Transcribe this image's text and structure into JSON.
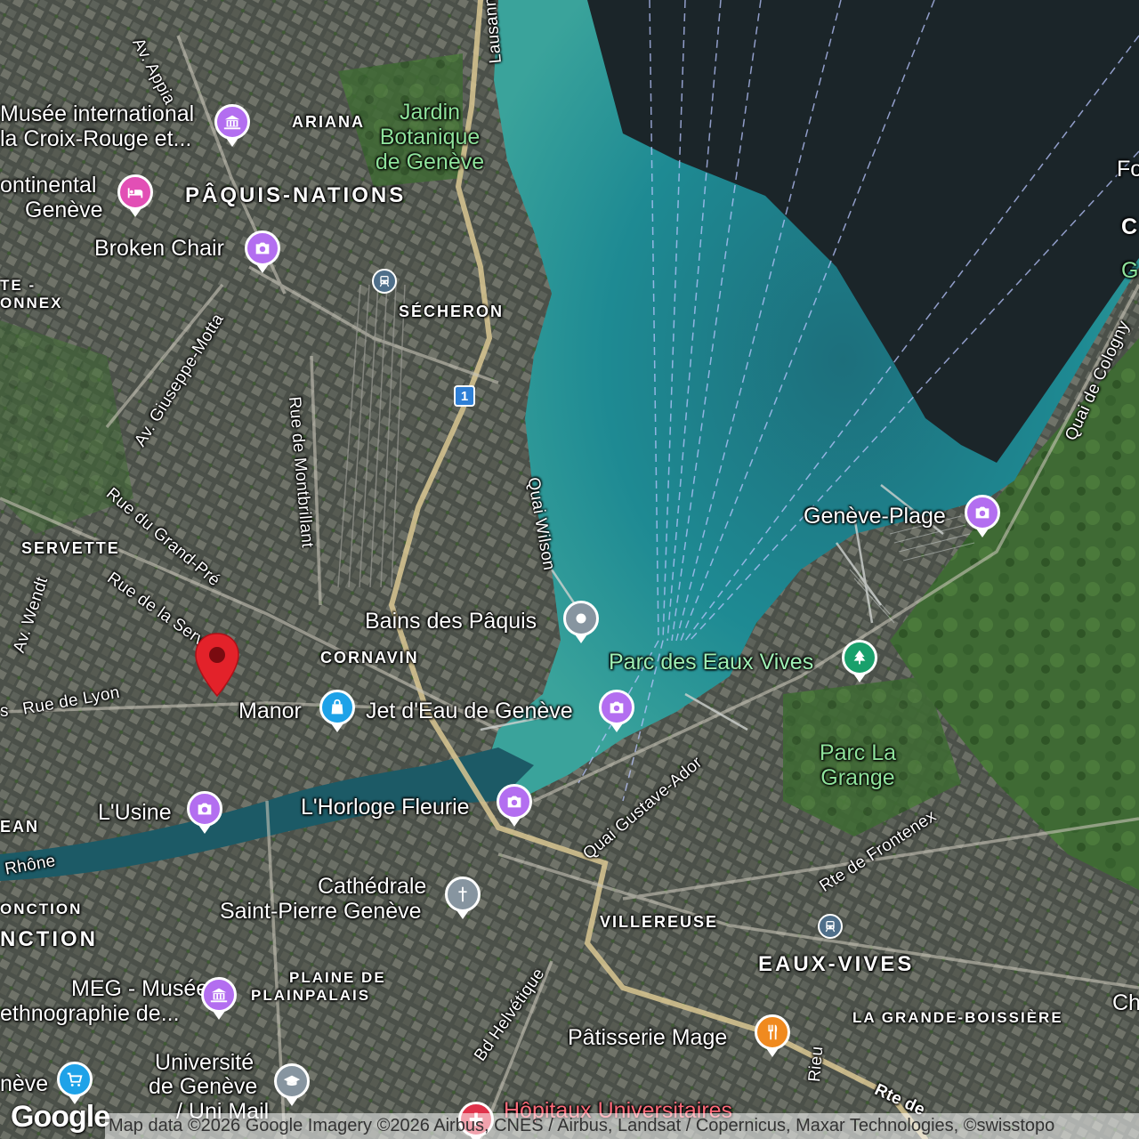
{
  "map": {
    "districts": {
      "ariana": "ARIANA",
      "paquis_nations": "PÂQUIS-NATIONS",
      "secheron": "SÉCHERON",
      "servette": "SERVETTE",
      "cornavin": "CORNAVIN",
      "villereuse": "VILLEREUSE",
      "eaux_vives": "EAUX-VIVES",
      "plaine_de_plainpalais_1": "PLAINE DE",
      "plaine_de_plainpalais_2": "PLAINPALAIS",
      "la_grande_boissiere": "LA GRANDE-BOISSIÈRE",
      "jonction_small": "ONCTION",
      "jonction_big": "NCTION",
      "petit_saconnex_1": "TE -",
      "petit_saconnex_2": "ONNEX",
      "ean": "EAN"
    },
    "streets": {
      "av_appia": "Av. Appia",
      "lausanne": "Lausanne",
      "av_giuseppe_motta": "Av. Giuseppe-Motta",
      "rue_de_montbrillant": "Rue de Montbrillant",
      "rue_du_grand_pre": "Rue du Grand-Pré",
      "rue_de_la_servette": "Rue de la Servette",
      "av_wendt": "Av. Wendt",
      "rue_de_lyon": "Rue de Lyon",
      "quai_wilson": "Quai Wilson",
      "quai_gustave_ador": "Quai Gustave-Ador",
      "rte_de_frontenex": "Rte de Frontenex",
      "quai_de_cologny": "Quai de Cologny",
      "bd_helvetique": "Bd Helvétique",
      "rhone": "Rhône",
      "rieu": "Rieu",
      "rte_de": "Rte de",
      "s": "s"
    },
    "pois": {
      "musee_croix_rouge_1": "Musée international",
      "musee_croix_rouge_2": "la Croix-Rouge et...",
      "intercontinental_1": "ontinental",
      "intercontinental_2": "Genève",
      "broken_chair": "Broken Chair",
      "jardin_botanique": "Jardin Botanique de Genève",
      "bains_des_paquis": "Bains des Pâquis",
      "geneve_plage": "Genève-Plage",
      "parc_des_eaux_vives": "Parc des Eaux Vives",
      "manor": "Manor",
      "jet_d_eau": "Jet d'Eau de Genève",
      "parc_la_grange": "Parc La Grange",
      "l_usine": "L'Usine",
      "l_horloge_fleurie": "L'Horloge Fleurie",
      "cathedrale_1": "Cathédrale",
      "cathedrale_2": "Saint-Pierre Genève",
      "meg_1": "MEG - Musée",
      "meg_2": "ethnographie de...",
      "universite_1": "Université",
      "universite_2": "de Genève",
      "universite_3": "/ Uni Mail",
      "patisserie_mage": "Pâtisserie Mage",
      "hopitaux": "Hôpitaux Universitaires",
      "geneve_shop": "nève"
    },
    "edge_labels": {
      "fo": "Fo",
      "c": "C",
      "g": "G",
      "ch": "Ch"
    },
    "route_shield": "1",
    "attribution": "Map data ©2026 Google Imagery ©2026 Airbus, CNES / Airbus, Landsat / Copernicus, Maxar Technologies, ©swisstopo",
    "logo": "Google",
    "colors": {
      "lake_deep": "#1b2529",
      "lake_shallow": "#1f7f8a",
      "attraction": "#b36ef0",
      "hotel": "#e24fb5",
      "shopping": "#1ea2e8",
      "park": "#19a06b",
      "food": "#f08a1f",
      "selected_pin": "#e3222a"
    }
  }
}
